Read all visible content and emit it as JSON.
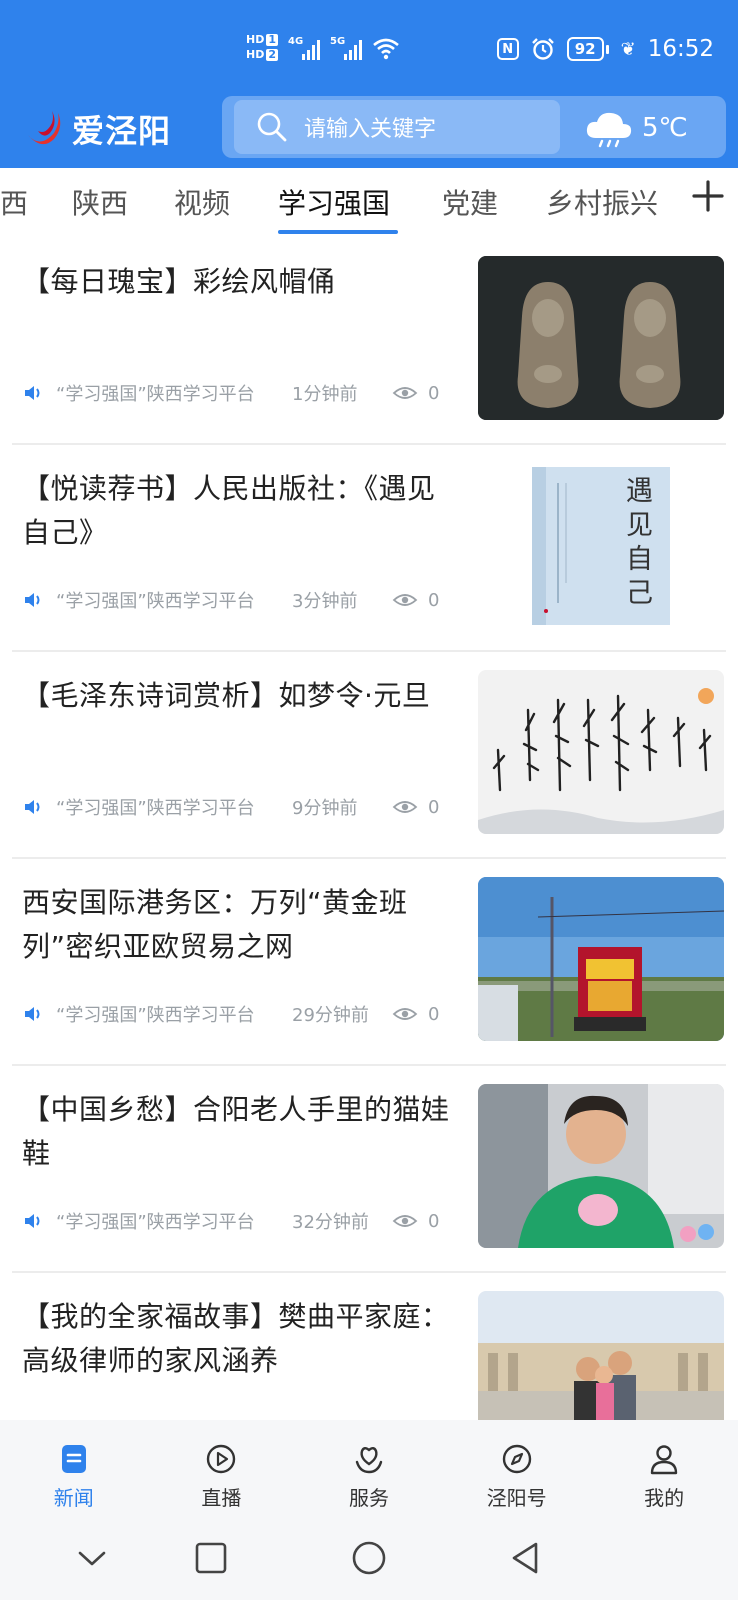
{
  "status_bar": {
    "hd1": "HD",
    "hd1_num": "1",
    "hd2": "HD",
    "hd2_num": "2",
    "net1": "4G",
    "net2": "5G",
    "nfc": "N",
    "battery": "92",
    "time": "16:52",
    "icons": [
      "hd-icon",
      "signal-icon",
      "wifi-icon",
      "nfc-icon",
      "alarm-icon",
      "battery-icon",
      "leaf-icon"
    ]
  },
  "app_bar": {
    "logo_text": "爱泾阳",
    "search_placeholder": "请输入关键字",
    "weather_temp": "5℃",
    "weather_icon": "cloud-rain-icon"
  },
  "tabs": [
    {
      "label": "西"
    },
    {
      "label": "陕西"
    },
    {
      "label": "视频"
    },
    {
      "label": "学习强国",
      "active": true
    },
    {
      "label": "党建"
    },
    {
      "label": "乡村振兴"
    }
  ],
  "feed": [
    {
      "title": "【每日瑰宝】彩绘风帽俑",
      "source": "“学习强国”陕西学习平台",
      "time": "1分钟前",
      "views": "0"
    },
    {
      "title": "【悦读荐书】人民出版社：《遇见自己》",
      "source": "“学习强国”陕西学习平台",
      "time": "3分钟前",
      "views": "0",
      "book_title": "遇见自己"
    },
    {
      "title": "【毛泽东诗词赏析】如梦令·元旦",
      "source": "“学习强国”陕西学习平台",
      "time": "9分钟前",
      "views": "0"
    },
    {
      "title": "西安国际港务区：万列“黄金班列”密织亚欧贸易之网",
      "source": "“学习强国”陕西学习平台",
      "time": "29分钟前",
      "views": "0"
    },
    {
      "title": "【中国乡愁】合阳老人手里的猫娃鞋",
      "source": "“学习强国”陕西学习平台",
      "time": "32分钟前",
      "views": "0"
    },
    {
      "title": "【我的全家福故事】樊曲平家庭：高级律师的家风涵养",
      "source": "",
      "time": "",
      "views": ""
    }
  ],
  "bottom_nav": [
    {
      "label": "新闻",
      "icon": "news-icon",
      "active": true
    },
    {
      "label": "直播",
      "icon": "live-icon"
    },
    {
      "label": "服务",
      "icon": "service-icon"
    },
    {
      "label": "泾阳号",
      "icon": "compass-icon"
    },
    {
      "label": "我的",
      "icon": "profile-icon"
    }
  ],
  "colors": {
    "accent": "#2f82ec",
    "meta_text": "#9aa0a6"
  }
}
